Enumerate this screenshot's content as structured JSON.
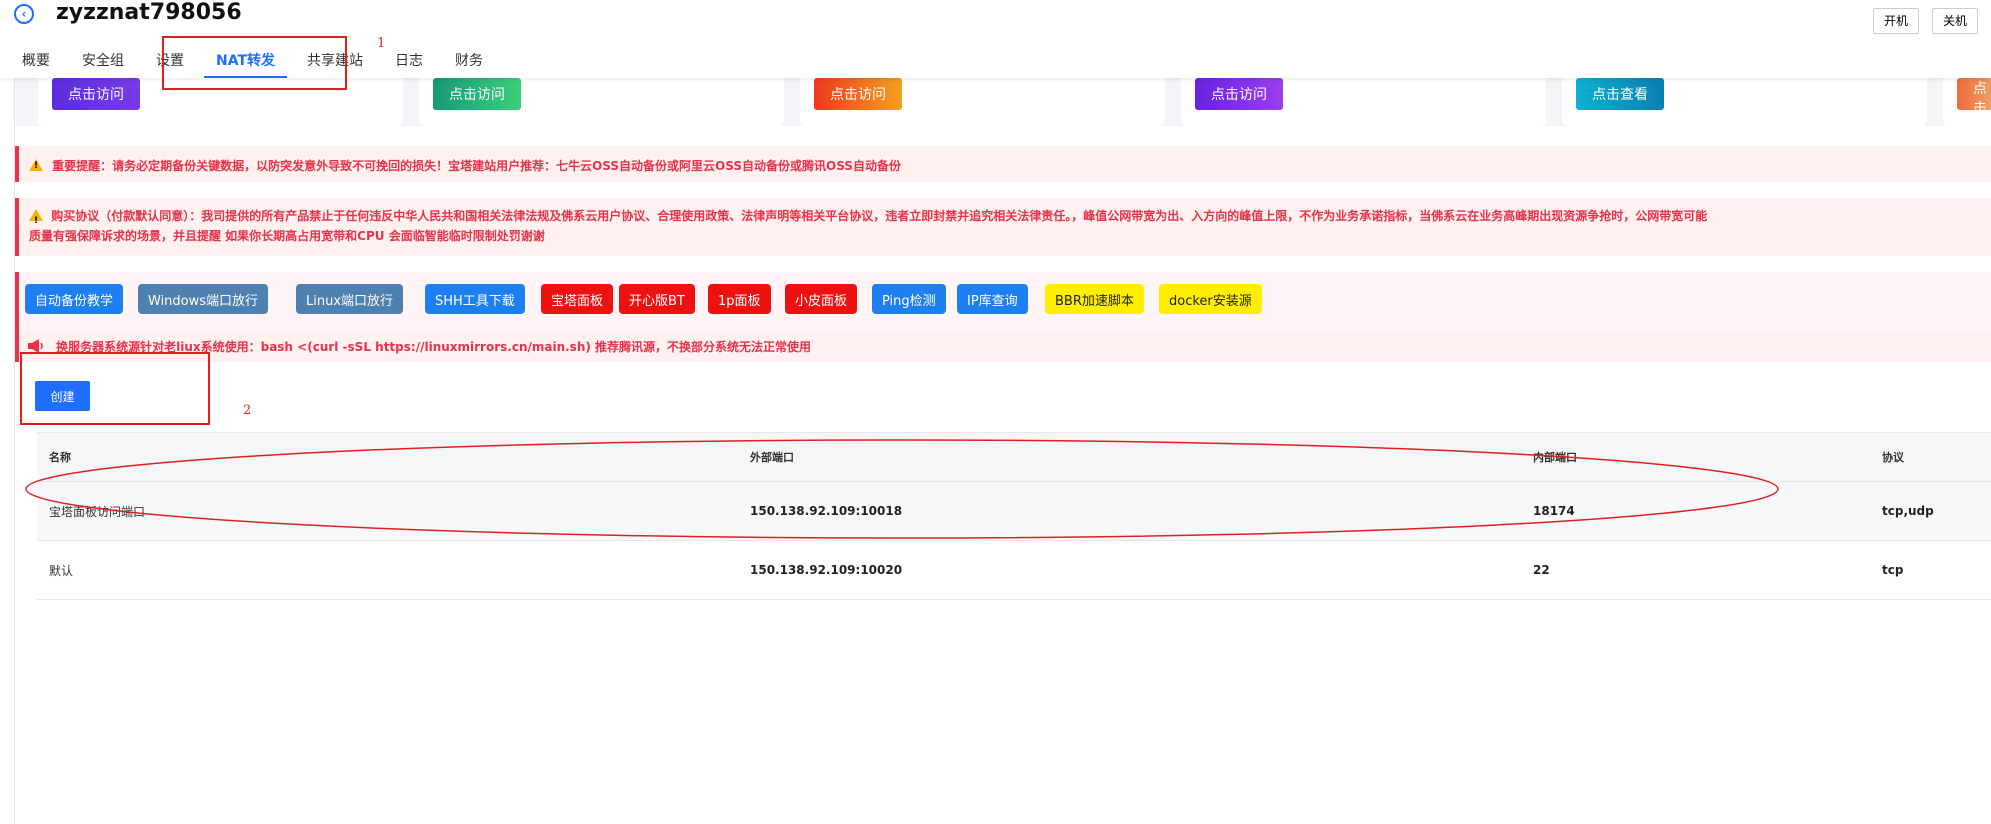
{
  "header": {
    "title": "zyzznat798056",
    "tabs": [
      {
        "label": "概要"
      },
      {
        "label": "安全组"
      },
      {
        "label": "设置"
      },
      {
        "label": "NAT转发"
      },
      {
        "label": "共享建站"
      },
      {
        "label": "日志"
      },
      {
        "label": "财务"
      }
    ],
    "power_on": "开机",
    "power_off": "关机"
  },
  "cards": [
    {
      "label": "点击访问",
      "color": "#6a2be0"
    },
    {
      "label": "点击访问",
      "color": "#1fb07a"
    },
    {
      "label": "点击访问",
      "color": "#f0531f"
    },
    {
      "label": "点击访问",
      "color": "#7a2de8"
    },
    {
      "label": "点击查看",
      "color": "#0f95c0"
    },
    {
      "label": "点击",
      "color": "#f07050"
    }
  ],
  "notices": {
    "important": "重要提醒：请务必定期备份关键数据，以防突发意外导致不可挽回的损失！宝塔建站用户推荐：七牛云OSS自动备份或阿里云OSS自动备份或腾讯OSS自动备份",
    "purchase_line1": "购买协议（付款默认同意）：我司提供的所有产品禁止于任何违反中华人民共和国相关法律法规及佛系云用户协议、合理使用政策、法律声明等相关平台协议，违者立即封禁并追究相关法律责任。，峰值公网带宽为出、入方向的峰值上限，不作为业务承诺指标，当佛系云在业务高峰期出现资源争抢时，公网带宽可能",
    "purchase_line2": "质量有强保障诉求的场景，并且提醒 如果你长期高占用宽带和CPU 会面临智能临时限制处罚谢谢",
    "mirror": "换服务器系统源针对老liux系统使用：bash <(curl -sSL https://linuxmirrors.cn/main.sh) 推荐腾讯源，不换部分系统无法正常使用"
  },
  "tools": [
    {
      "label": "自动备份教学",
      "bg": "#1e7ff0",
      "fg": "#ffffff"
    },
    {
      "label": "Windows端口放行",
      "bg": "#4f81b0",
      "fg": "#ffffff"
    },
    {
      "label": "Linux端口放行",
      "bg": "#4f81b0",
      "fg": "#ffffff"
    },
    {
      "label": "SHH工具下载",
      "bg": "#1e7ff0",
      "fg": "#ffffff"
    },
    {
      "label": "宝塔面板",
      "bg": "#ee1111",
      "fg": "#ffffff"
    },
    {
      "label": "开心版BT",
      "bg": "#ee1111",
      "fg": "#ffffff"
    },
    {
      "label": "1p面板",
      "bg": "#ee1111",
      "fg": "#ffffff"
    },
    {
      "label": "小皮面板",
      "bg": "#ee1111",
      "fg": "#ffffff"
    },
    {
      "label": "Ping检测",
      "bg": "#1e7ff0",
      "fg": "#ffffff"
    },
    {
      "label": "IP库查询",
      "bg": "#1e7ff0",
      "fg": "#ffffff"
    },
    {
      "label": "BBR加速脚本",
      "bg": "#ffee00",
      "fg": "#222222"
    },
    {
      "label": "docker安装源",
      "bg": "#ffee00",
      "fg": "#222222"
    }
  ],
  "create_label": "创建",
  "annotations": {
    "one": "1",
    "two": "2"
  },
  "table": {
    "headers": [
      "名称",
      "外部端口",
      "内部端口",
      "协议"
    ],
    "rows": [
      [
        "宝塔面板访问端口",
        "150.138.92.109:10018",
        "18174",
        "tcp,udp"
      ],
      [
        "默认",
        "150.138.92.109:10020",
        "22",
        "tcp"
      ]
    ]
  },
  "colors": {
    "accent": "#1e6fff",
    "danger": "#e8334a",
    "annotation": "#e02020"
  }
}
